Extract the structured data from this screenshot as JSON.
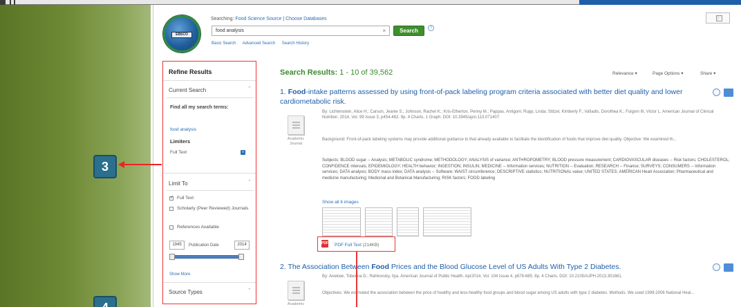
{
  "header": {
    "searching_label": "Searching:",
    "database": "Food Science Source",
    "choose_databases": "Choose Databases",
    "search_value": "food analysis",
    "search_button": "Search",
    "help_icon": "question-mark-icon",
    "links": [
      "Basic Search",
      "Advanced Search",
      "Search History"
    ]
  },
  "refine": {
    "title": "Refine Results",
    "current_search": "Current Search",
    "find_all": "Find all my search terms:",
    "query": "food analysis",
    "limiters_label": "Limiters",
    "fulltext_limiter": "Full Text",
    "limit_to": "Limit To",
    "options": [
      {
        "label": "Full Text",
        "checked": true
      },
      {
        "label": "Scholarly (Peer Reviewed) Journals",
        "checked": false
      },
      {
        "label": "References Available",
        "checked": false
      }
    ],
    "date_from": "1945",
    "date_label": "Publication Date",
    "date_to": "2014",
    "show_more": "Show More",
    "source_types": "Source Types"
  },
  "callouts": {
    "first": "3",
    "second": "4"
  },
  "results_header": {
    "label": "Search Results:",
    "count": "1 - 10 of 39,562",
    "relevance": "Relevance ▾",
    "page_options": "Page Options ▾",
    "share": "Share ▾"
  },
  "results": [
    {
      "num": "1.",
      "title_lead": "Food",
      "title_rest": "-intake patterns assessed by using front-of-pack labeling program criteria associated with better diet quality and lower cardiometabolic risk.",
      "meta": "By: Lichtenstein, Alice H.; Carson, Jeanie S.; Johnson, Rachel K.; Kris-Etherton, Penny M.; Pappas, Antigoni; Rupp, Linda; Stitzel, Kimberly F.; Vafiadis, Dorothea K.; Fulgoni III, Victor L. American Journal of Clinical Nutrition. 2014, Vol. 99 Issue 3, p454-462. 9p. 4 Charts, 1 Graph. DOI: 10.3945/ajcn.113.071407.",
      "abstract": "Background: Front-of-pack labeling systems may provide additional guidance to that already available to facilitate the identification of foods that improve diet quality. Objective: We examined th...",
      "subjects": "Subjects: BLOOD sugar -- Analysis; METABOLIC syndrome; METHODOLOGY; ANALYSIS of variance; ANTHROPOMETRY; BLOOD pressure measurement; CARDIOVASCULAR diseases -- Risk factors; CHOLESTEROL; CONFIDENCE intervals; EPIDEMIOLOGY; HEALTH behavior; INGESTION; INSULIN; MEDICINE -- Information services; NUTRITION -- Evaluation; RESEARCH -- Finance; SURVEYS; CONSUMERS -- Information services; DATA analysis; BODY mass index; DATA analysis -- Software; WAIST circumference; DESCRIPTIVE statistics; NUTRITIONAL value; UNITED STATES; AMERICAN Heart Association; Pharmaceutical and medicine manufacturing; Medicinal and Botanical Manufacturing; RISK factors; FOOD labeling",
      "pub_type": "Academic Journal",
      "show_images": "Show all 6 images",
      "pdf_label": "PDF Full Text",
      "pdf_size": "(214KB)"
    },
    {
      "num": "2.",
      "title_pre": "The Association Between ",
      "title_lead": "Food",
      "title_rest": " Prices and the Blood Glucose Level of US Adults With Type 2 Diabetes.",
      "meta": "By: Anekwe, Tobenna D.; Rahkovsky, Ilya. American Journal of Public Health. Apr2014, Vol. 104 Issue 4, p678-685. 8p. 4 Charts. DOI: 10.2105/AJPH.2013.301661.",
      "abstract": "Objectives. We estimated the association between the price of healthy and less-healthy food groups and blood sugar among US adults with type 2 diabetes. Methods. We used 1999-2006 National Heal...",
      "pub_type": "Academic"
    }
  ]
}
